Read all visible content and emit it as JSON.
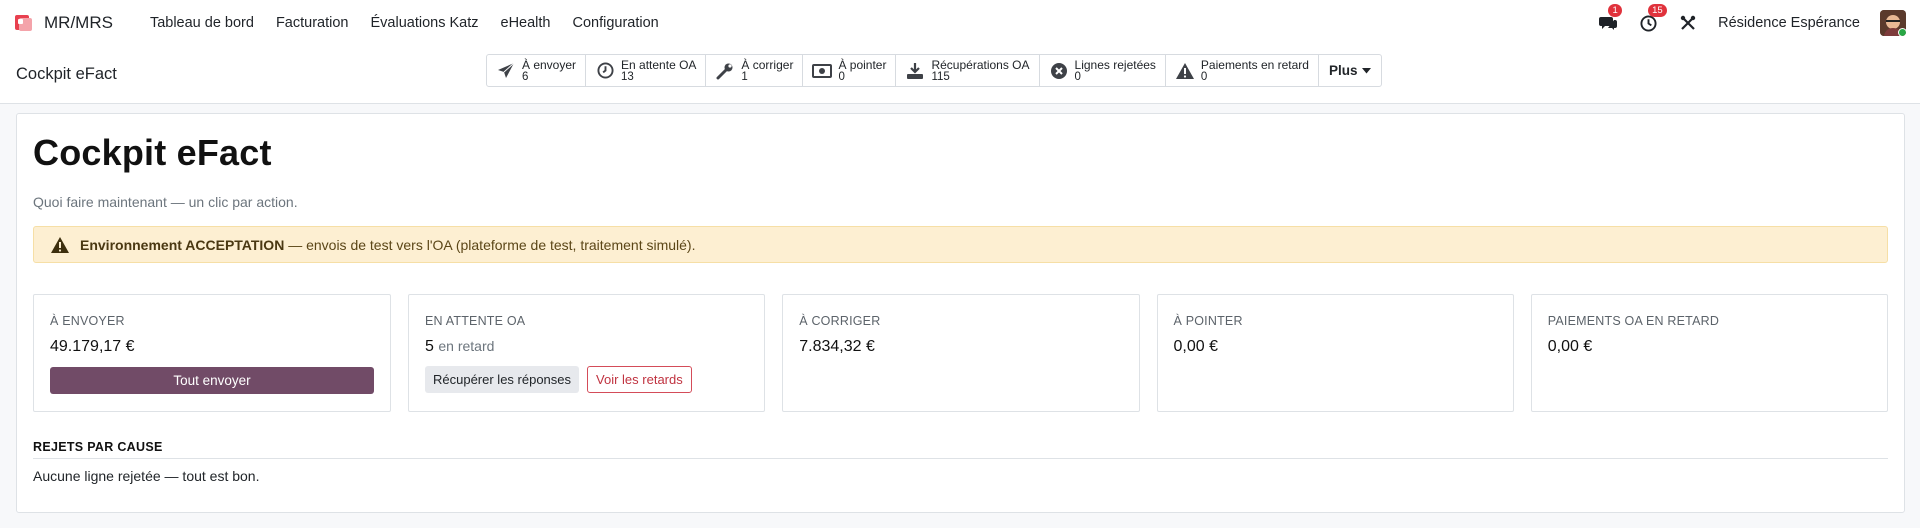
{
  "nav": {
    "brand": "MR/MRS",
    "menu": [
      "Tableau de bord",
      "Facturation",
      "Évaluations Katz",
      "eHealth",
      "Configuration"
    ],
    "messages_count": "1",
    "activities_count": "15",
    "company": "Résidence Espérance"
  },
  "control": {
    "breadcrumb": "Cockpit eFact",
    "filters": [
      {
        "label": "À envoyer",
        "count": "6",
        "icon": "paper-plane-icon"
      },
      {
        "label": "En attente OA",
        "count": "13",
        "icon": "clock-icon"
      },
      {
        "label": "À corriger",
        "count": "1",
        "icon": "wrench-icon"
      },
      {
        "label": "À pointer",
        "count": "0",
        "icon": "money-icon"
      },
      {
        "label": "Récupérations OA",
        "count": "115",
        "icon": "download-icon"
      },
      {
        "label": "Lignes rejetées",
        "count": "0",
        "icon": "times-circle-icon"
      },
      {
        "label": "Paiements en retard",
        "count": "0",
        "icon": "warning-icon"
      }
    ],
    "more_label": "Plus"
  },
  "main": {
    "title": "Cockpit eFact",
    "subtitle": "Quoi faire maintenant — un clic par action.",
    "alert": {
      "strong": "Environnement ACCEPTATION",
      "text": " — envois de test vers l'OA (plateforme de test, traitement simulé)."
    },
    "cards": [
      {
        "label": "À ENVOYER",
        "value": "49.179,17 €",
        "button": "Tout envoyer"
      },
      {
        "label": "EN ATTENTE OA",
        "value": "5",
        "value_suffix": "en retard",
        "button_1": "Récupérer les réponses",
        "button_2": "Voir les retards"
      },
      {
        "label": "À CORRIGER",
        "value": "7.834,32 €"
      },
      {
        "label": "À POINTER",
        "value": "0,00 €"
      },
      {
        "label": "PAIEMENTS OA EN RETARD",
        "value": "0,00 €"
      }
    ],
    "rejects": {
      "title": "REJETS PAR CAUSE",
      "text": "Aucune ligne rejetée — tout est bon."
    }
  },
  "colors": {
    "primary": "#714b67",
    "badge": "#e0323c",
    "alert_bg": "#fdefd2",
    "danger": "#c03340"
  }
}
